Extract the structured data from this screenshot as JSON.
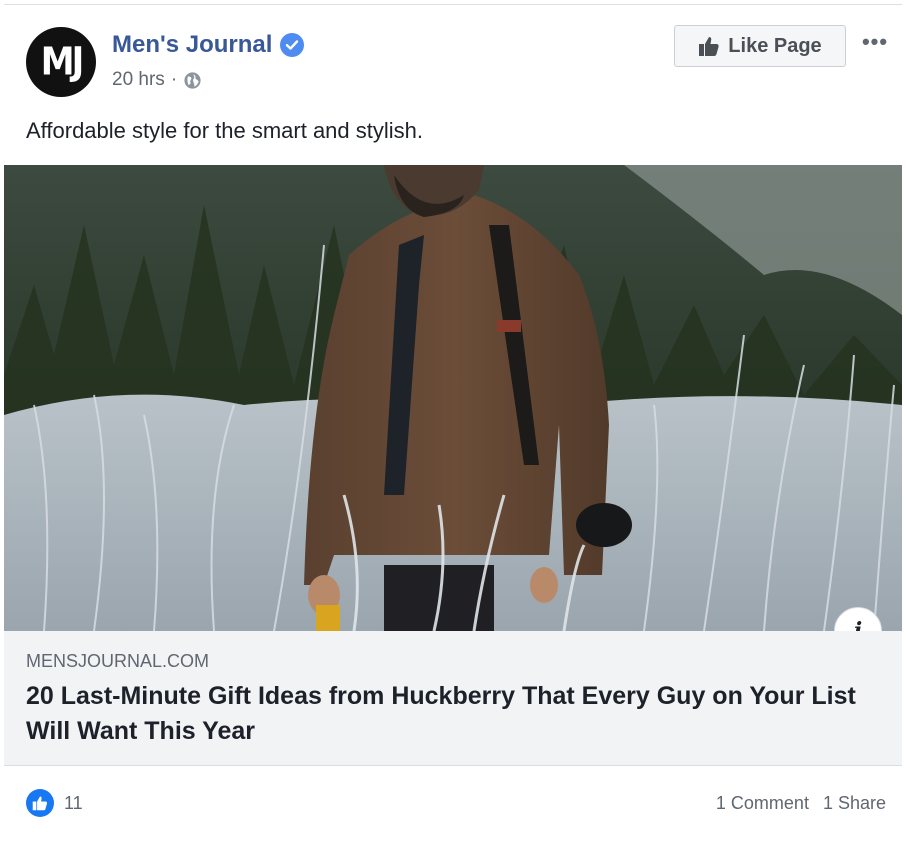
{
  "post": {
    "page_name": "Men's Journal",
    "avatar_text": "MJ",
    "time": "20 hrs",
    "separator": "·",
    "caption": "Affordable style for the smart and stylish.",
    "like_page_label": "Like Page",
    "more_label": "•••"
  },
  "link": {
    "domain": "MENSJOURNAL.COM",
    "headline": "20 Last-Minute Gift Ideas from Huckberry That Every Guy on Your List Will Want This Year",
    "info_label": "i"
  },
  "footer": {
    "like_count": "11",
    "comments": "1 Comment",
    "shares": "1 Share"
  },
  "colors": {
    "brand_blue": "#385898",
    "like_blue": "#1877f2",
    "verified_blue": "#4e8cf2"
  },
  "icons": [
    "verified-badge-icon",
    "globe-icon",
    "thumbs-up-icon",
    "more-options-icon",
    "info-icon"
  ]
}
